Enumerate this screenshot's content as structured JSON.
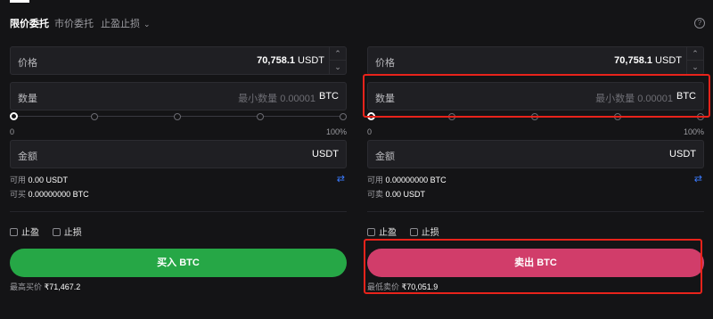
{
  "tabs": {
    "limit": "限价委托",
    "market": "市价委托",
    "tpsl": "止盈止损",
    "chevron": "⌄",
    "help": "?"
  },
  "buy": {
    "price_label": "价格",
    "price_value": "70,758.1",
    "price_unit": "USDT",
    "qty_label": "数量",
    "qty_placeholder": "最小数量 0.00001",
    "qty_unit": "BTC",
    "slider_min": "0",
    "slider_max": "100%",
    "slider_percent": 0,
    "amount_label": "金额",
    "amount_unit": "USDT",
    "avail_label": "可用",
    "avail_value": "0.00 USDT",
    "can_label": "可买",
    "can_value": "0.00000000 BTC",
    "tp_label": "止盈",
    "sl_label": "止损",
    "button_label": "买入 BTC",
    "best_label": "最高买价",
    "best_value": "₹71,467.2"
  },
  "sell": {
    "price_label": "价格",
    "price_value": "70,758.1",
    "price_unit": "USDT",
    "qty_label": "数量",
    "qty_placeholder": "最小数量 0.00001",
    "qty_unit": "BTC",
    "slider_min": "0",
    "slider_max": "100%",
    "slider_percent": 0,
    "amount_label": "金额",
    "amount_unit": "USDT",
    "avail_label": "可用",
    "avail_value": "0.00000000 BTC",
    "can_label": "可卖",
    "can_value": "0.00 USDT",
    "tp_label": "止盈",
    "sl_label": "止损",
    "button_label": "卖出 BTC",
    "best_label": "最低卖价",
    "best_value": "₹70,051.9"
  },
  "icons": {
    "up": "⌃",
    "down": "⌄",
    "swap": "⇄"
  },
  "colors": {
    "buy": "#26a746",
    "sell": "#d13d6a",
    "highlight": "#e8231b",
    "swap": "#3b7bff"
  }
}
